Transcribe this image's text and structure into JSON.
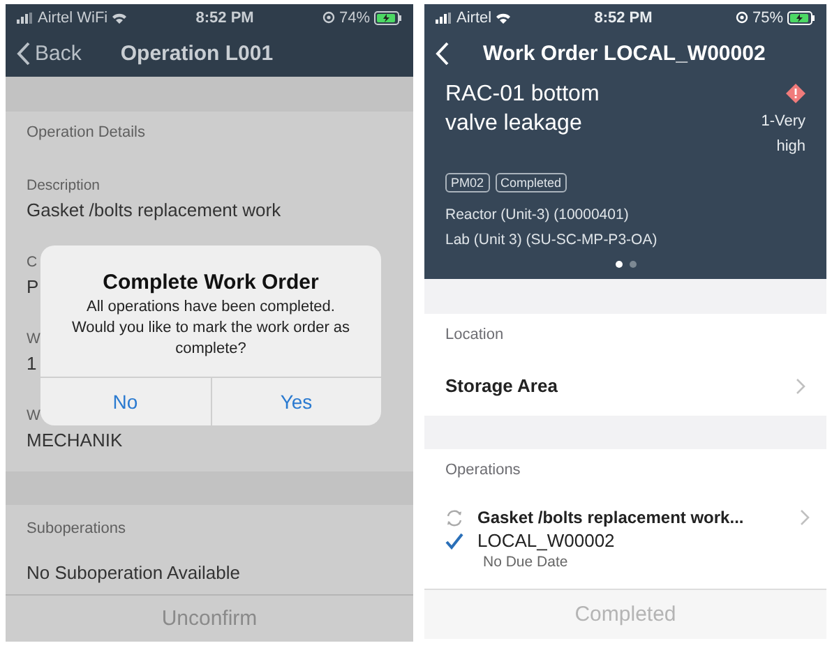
{
  "operation_screen": {
    "status_bar": {
      "carrier": "Airtel WiFi",
      "time": "8:52 PM",
      "battery": "74%"
    },
    "nav": {
      "back": "Back",
      "title": "Operation L001"
    },
    "details": {
      "heading": "Operation Details",
      "fields": [
        {
          "label": "Description",
          "value": "Gasket /bolts replacement work"
        },
        {
          "label": "C",
          "value": "P"
        },
        {
          "label": "W",
          "value": "1"
        },
        {
          "label": "W",
          "value": "MECHANIK"
        }
      ]
    },
    "suboperations": {
      "heading": "Suboperations",
      "empty_text": "No Suboperation Available"
    },
    "footer_button": {
      "label": "Unconfirm"
    },
    "dialog": {
      "title": "Complete Work Order",
      "message": "All operations have been completed. Would you like to mark the work order as complete?",
      "buttons": [
        "No",
        "Yes"
      ]
    }
  },
  "work_order_screen": {
    "status_bar": {
      "carrier": "Airtel",
      "time": "8:52 PM",
      "battery": "75%"
    },
    "nav": {
      "title": "Work Order LOCAL_W00002"
    },
    "header": {
      "title": "RAC-01 bottom valve leakage",
      "priority": "1-Very high",
      "tags": [
        "PM02",
        "Completed"
      ],
      "lines": [
        "Reactor (Unit-3) (10000401)",
        "Lab (Unit 3) (SU-SC-MP-P3-OA)"
      ],
      "pages": [
        {
          "selected": true
        },
        {
          "selected": false
        }
      ]
    },
    "location": {
      "heading": "Location",
      "value": "Storage Area"
    },
    "operations": {
      "heading": "Operations",
      "items": [
        {
          "title": "Gasket /bolts replacement work...",
          "id": "LOCAL_W00002",
          "due": "No Due Date",
          "checked": true
        }
      ]
    },
    "footer_button": {
      "label": "Completed",
      "disabled": true
    }
  }
}
